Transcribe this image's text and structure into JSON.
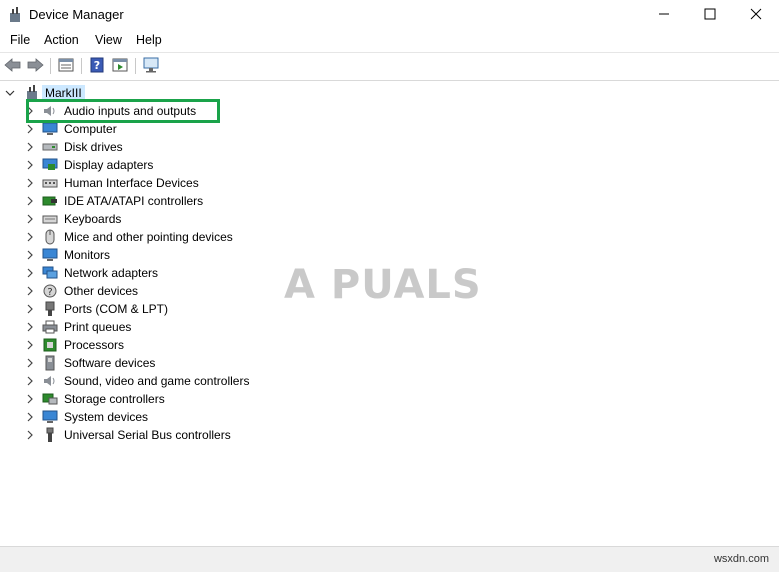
{
  "window": {
    "title": "Device Manager",
    "app_icon": "device-manager-icon",
    "controls": [
      "minimize-icon",
      "maximize-icon",
      "close-icon"
    ]
  },
  "menu": {
    "file": "File",
    "action": "Action",
    "view": "View",
    "help": "Help"
  },
  "toolbar": {
    "icons": [
      "back-arrow-icon",
      "forward-arrow-icon",
      "properties-icon",
      "help-icon",
      "run-icon",
      "monitor-icon"
    ]
  },
  "tree": {
    "root": "MarkIII",
    "categories": [
      {
        "label": "Audio inputs and outputs",
        "icon": "speaker-icon"
      },
      {
        "label": "Computer",
        "icon": "computer-icon"
      },
      {
        "label": "Disk drives",
        "icon": "disk-drive-icon"
      },
      {
        "label": "Display adapters",
        "icon": "display-adapter-icon"
      },
      {
        "label": "Human Interface Devices",
        "icon": "hid-icon"
      },
      {
        "label": "IDE ATA/ATAPI controllers",
        "icon": "ide-controller-icon"
      },
      {
        "label": "Keyboards",
        "icon": "keyboard-icon"
      },
      {
        "label": "Mice and other pointing devices",
        "icon": "mouse-icon"
      },
      {
        "label": "Monitors",
        "icon": "monitor-icon"
      },
      {
        "label": "Network adapters",
        "icon": "network-adapter-icon"
      },
      {
        "label": "Other devices",
        "icon": "other-devices-icon"
      },
      {
        "label": "Ports (COM & LPT)",
        "icon": "port-icon"
      },
      {
        "label": "Print queues",
        "icon": "printer-icon"
      },
      {
        "label": "Processors",
        "icon": "processor-icon"
      },
      {
        "label": "Software devices",
        "icon": "software-device-icon"
      },
      {
        "label": "Sound, video and game controllers",
        "icon": "speaker-icon"
      },
      {
        "label": "Storage controllers",
        "icon": "storage-controller-icon"
      },
      {
        "label": "System devices",
        "icon": "system-devices-icon"
      },
      {
        "label": "Universal Serial Bus controllers",
        "icon": "usb-icon"
      }
    ]
  },
  "watermark": "A PUALS",
  "status": {
    "site": "wsxdn.com"
  },
  "colors": {
    "highlight_border": "#1aa34a",
    "selection": "#cce8ff"
  }
}
